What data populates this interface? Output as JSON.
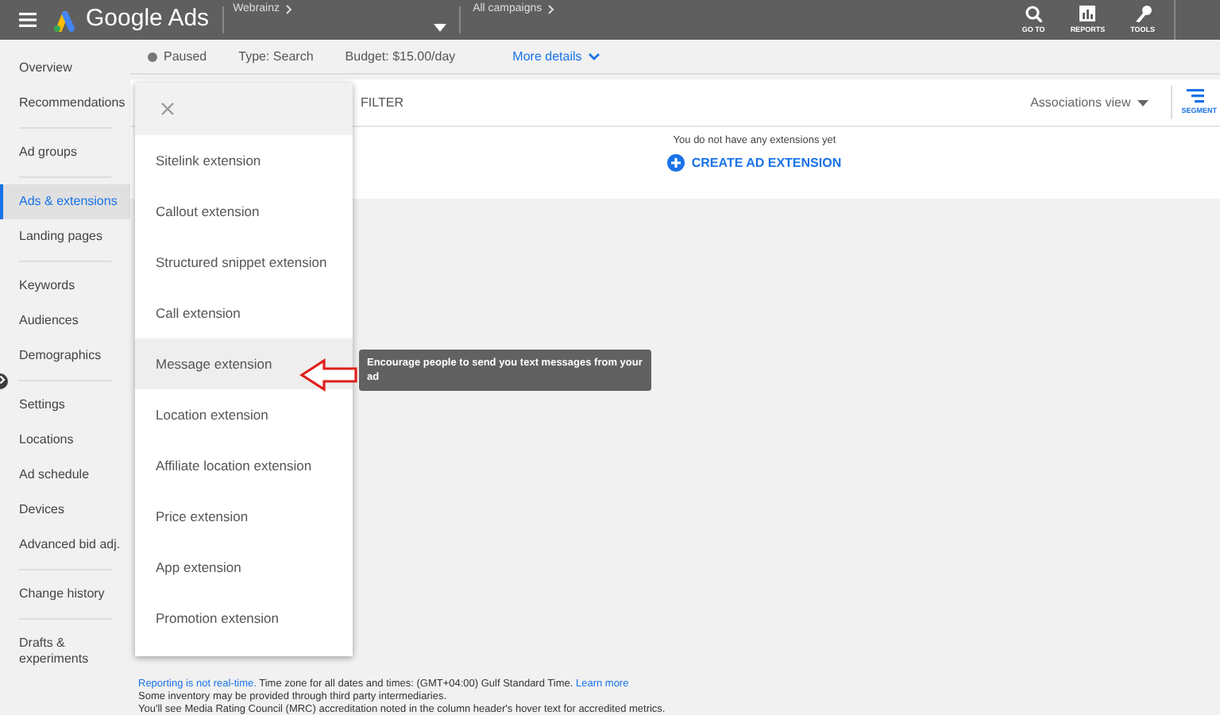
{
  "header": {
    "app_name": "Google Ads",
    "account": "Webrainz",
    "campaign_scope": "All campaigns",
    "tools": [
      {
        "kind": "search",
        "label": "GO TO"
      },
      {
        "kind": "reports",
        "label": "REPORTS"
      },
      {
        "kind": "tools",
        "label": "TOOLS"
      }
    ]
  },
  "sidebar": {
    "groups": [
      [
        {
          "label": "Overview",
          "selected": false
        },
        {
          "label": "Recommendations",
          "selected": false
        }
      ],
      [
        {
          "label": "Ad groups",
          "selected": false
        }
      ],
      [
        {
          "label": "Ads & extensions",
          "selected": true
        },
        {
          "label": "Landing pages",
          "selected": false
        }
      ],
      [
        {
          "label": "Keywords",
          "selected": false
        },
        {
          "label": "Audiences",
          "selected": false
        },
        {
          "label": "Demographics",
          "selected": false
        }
      ],
      [
        {
          "label": "Settings",
          "selected": false
        },
        {
          "label": "Locations",
          "selected": false
        },
        {
          "label": "Ad schedule",
          "selected": false
        },
        {
          "label": "Devices",
          "selected": false
        },
        {
          "label": "Advanced bid adj.",
          "selected": false
        }
      ],
      [
        {
          "label": "Change history",
          "selected": false
        }
      ],
      [
        {
          "label": "Drafts & experiments",
          "selected": false
        }
      ]
    ]
  },
  "campaign_bar": {
    "status": "Paused",
    "type": "Type: Search",
    "budget": "Budget: $15.00/day",
    "more_details": "More details"
  },
  "toolbar": {
    "filter": "FILTER",
    "view": "Associations view",
    "segment": "SEGMENT"
  },
  "empty_state": {
    "message": "You do not have any extensions yet",
    "action": "CREATE AD EXTENSION"
  },
  "extension_menu": {
    "items": [
      {
        "label": "Sitelink extension",
        "selected": false
      },
      {
        "label": "Callout extension",
        "selected": false
      },
      {
        "label": "Structured snippet extension",
        "selected": false
      },
      {
        "label": "Call extension",
        "selected": false
      },
      {
        "label": "Message extension",
        "selected": true
      },
      {
        "label": "Location extension",
        "selected": false
      },
      {
        "label": "Affiliate location extension",
        "selected": false
      },
      {
        "label": "Price extension",
        "selected": false
      },
      {
        "label": "App extension",
        "selected": false
      },
      {
        "label": "Promotion extension",
        "selected": false
      }
    ]
  },
  "tooltip": "Encourage people to send you text messages from your ad",
  "footer": {
    "line_1_link": "Reporting is not real-time.",
    "line_1_text": "Time zone for all dates and times: (GMT+04:00) Gulf Standard Time.",
    "line_1_learn_more": "Learn more",
    "line_2": "Some inventory may be provided through third party intermediaries.",
    "line_3": "You'll see Media Rating Council (MRC) accreditation noted in the column header's hover text for accredited metrics."
  }
}
